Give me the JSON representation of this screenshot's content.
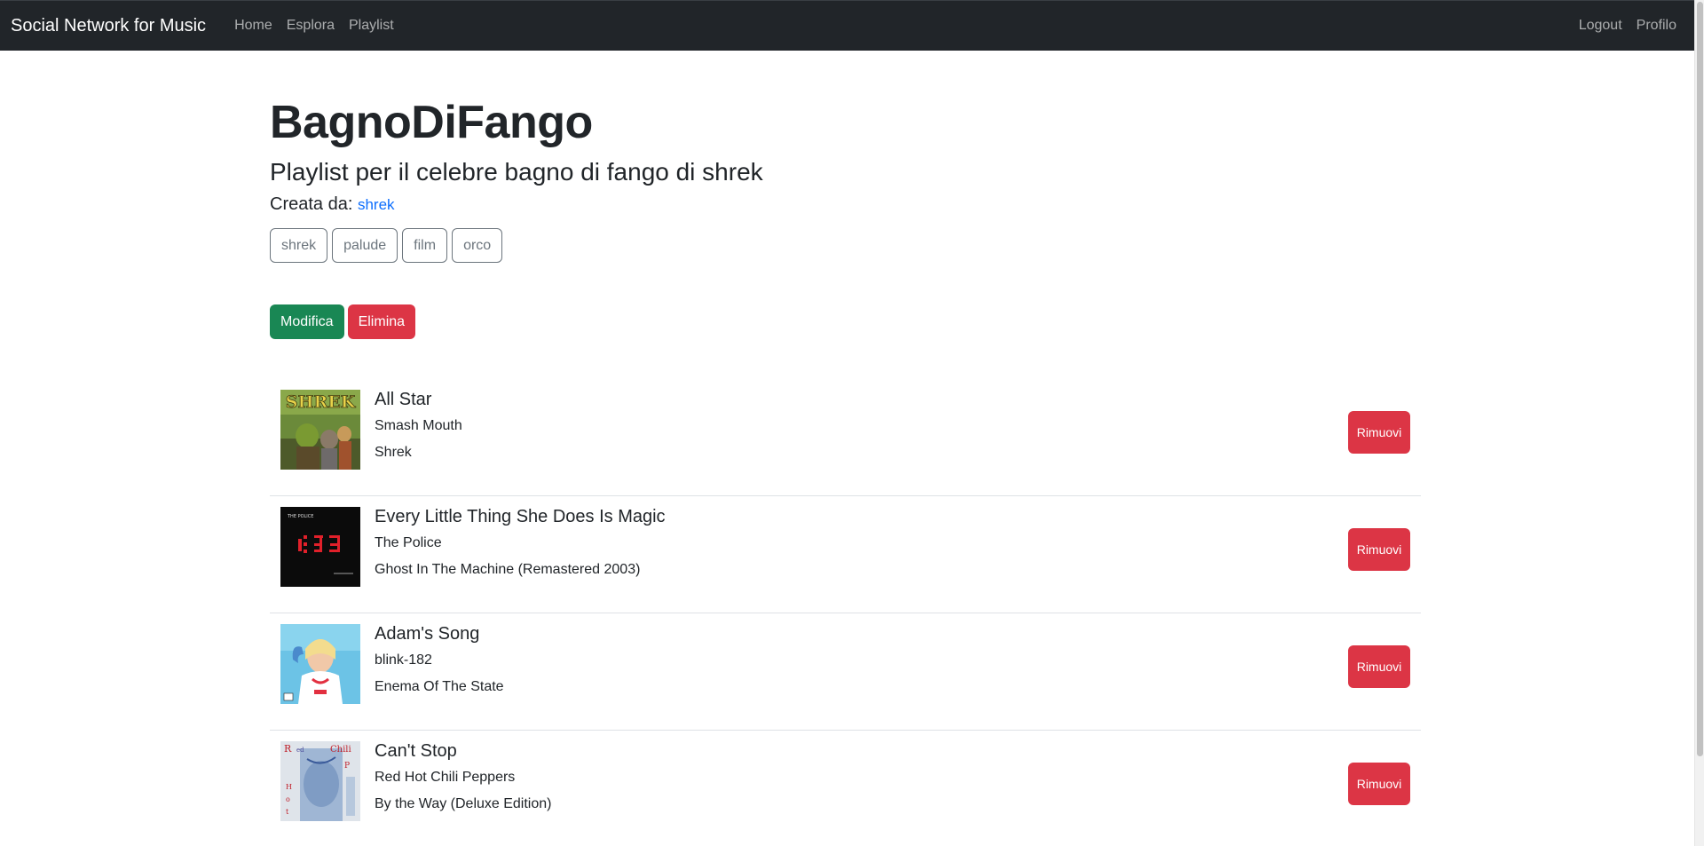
{
  "navbar": {
    "brand": "Social Network for Music",
    "links": [
      "Home",
      "Esplora",
      "Playlist"
    ],
    "right_links": [
      "Logout",
      "Profilo"
    ],
    "background": "#212529"
  },
  "playlist": {
    "title": "BagnoDiFango",
    "description": "Playlist per il celebre bagno di fango di shrek",
    "creator_label": "Creata da:",
    "creator": "shrek",
    "tags": [
      "shrek",
      "palude",
      "film",
      "orco"
    ],
    "edit_label": "Modifica",
    "delete_label": "Elimina"
  },
  "tracks": [
    {
      "title": "All Star",
      "artist": "Smash Mouth",
      "album": "Shrek",
      "remove_label": "Rimuovi"
    },
    {
      "title": "Every Little Thing She Does Is Magic",
      "artist": "The Police",
      "album": "Ghost In The Machine (Remastered 2003)",
      "remove_label": "Rimuovi"
    },
    {
      "title": "Adam's Song",
      "artist": "blink-182",
      "album": "Enema Of The State",
      "remove_label": "Rimuovi"
    },
    {
      "title": "Can't Stop",
      "artist": "Red Hot Chili Peppers",
      "album": "By the Way (Deluxe Edition)",
      "remove_label": "Rimuovi"
    }
  ],
  "colors": {
    "success": "#198754",
    "danger": "#dc3545",
    "link": "#0d6efd",
    "secondary": "#6c757d"
  }
}
